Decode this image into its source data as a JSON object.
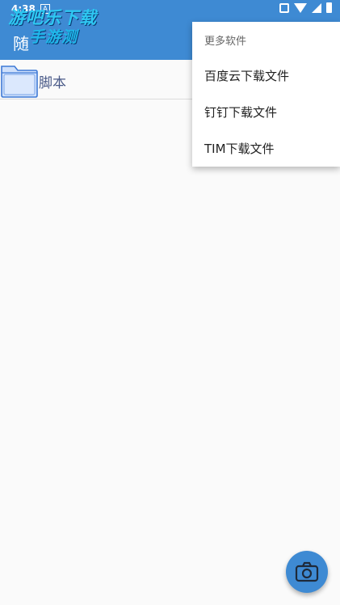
{
  "status_bar": {
    "time": "4:38",
    "notification_badge": "A",
    "icons": [
      "vibrate-icon",
      "wifi-icon",
      "cellular-icon",
      "battery-icon"
    ]
  },
  "watermark": {
    "line1": "游吧乐下载",
    "line2": "手游测"
  },
  "app_bar": {
    "title": "随",
    "color": "#3e8ad3"
  },
  "file_list": {
    "items": [
      {
        "label": "脚本",
        "icon": "folder-icon"
      }
    ]
  },
  "overflow_menu": {
    "header": "更多软件",
    "items": [
      {
        "label": "百度云下载文件"
      },
      {
        "label": "钉钉下载文件"
      },
      {
        "label": "TIM下载文件"
      }
    ]
  },
  "fab": {
    "icon": "camera-icon"
  }
}
